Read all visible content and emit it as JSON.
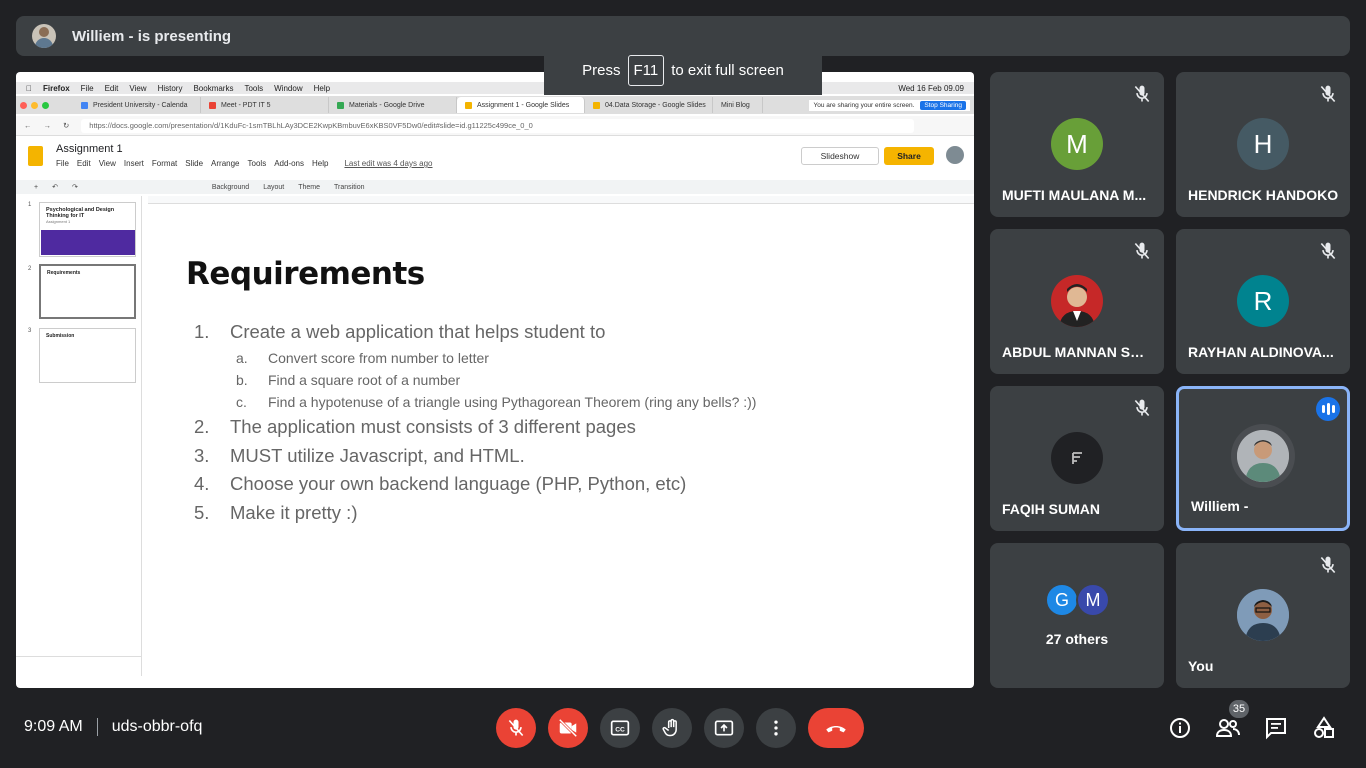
{
  "presenting": {
    "label": "Williem - is presenting"
  },
  "fullscreen_toast": {
    "press": "Press",
    "key": "F11",
    "suffix": "to exit full screen"
  },
  "shared_screen": {
    "mac_menu": [
      "Firefox",
      "File",
      "Edit",
      "View",
      "History",
      "Bookmarks",
      "Tools",
      "Window",
      "Help"
    ],
    "clock": "Wed 16 Feb  09.09",
    "tabs": [
      {
        "label": "President University - Calenda",
        "color": "#4285f4"
      },
      {
        "label": "Meet - PDT IT 5",
        "color": "#ea4335"
      },
      {
        "label": "Materials - Google Drive",
        "color": "#34a853"
      },
      {
        "label": "Assignment 1 - Google Slides",
        "color": "#f4b400"
      },
      {
        "label": "04.Data Storage - Google Slides",
        "color": "#f4b400"
      },
      {
        "label": "Mini Blog",
        "color": "#888888"
      }
    ],
    "share_notice": "You are sharing your entire screen.",
    "stop_sharing": "Stop Sharing",
    "url": "https://docs.google.com/presentation/d/1KduFc-1smTBLhLAy3DCE2KwpKBmbuvE6xKBS0VF5Dw0/edit#slide=id.g11225c499ce_0_0",
    "doc_title": "Assignment 1",
    "doc_menu": [
      "File",
      "Edit",
      "View",
      "Insert",
      "Format",
      "Slide",
      "Arrange",
      "Tools",
      "Add-ons",
      "Help"
    ],
    "last_edit": "Last edit was 4 days ago",
    "slideshow": "Slideshow",
    "share": "Share",
    "toolbar": [
      "Background",
      "Layout",
      "Theme",
      "Transition"
    ],
    "thumbnails": [
      {
        "num": "1",
        "title": "Psychological and Design Thinking for IT",
        "subtitle": "Assignment 1"
      },
      {
        "num": "2",
        "title": "Requirements"
      },
      {
        "num": "3",
        "title": "Submission"
      }
    ],
    "slide": {
      "title": "Requirements",
      "items": [
        {
          "num": "1.",
          "text": "Create a web application that helps student to"
        },
        {
          "num": "a.",
          "text": "Convert score from number to letter"
        },
        {
          "num": "b.",
          "text": "Find a square root of a number"
        },
        {
          "num": "c.",
          "text": "Find a hypotenuse of a triangle using Pythagorean Theorem (ring any bells? :))"
        },
        {
          "num": "2.",
          "text": "The application must consists of 3 different pages"
        },
        {
          "num": "3.",
          "text": "MUST utilize Javascript, and HTML."
        },
        {
          "num": "4.",
          "text": "Choose your own backend language (PHP, Python, etc)"
        },
        {
          "num": "5.",
          "text": "Make it pretty :)"
        }
      ]
    }
  },
  "participants": [
    {
      "name": "MUFTI MAULANA M...",
      "initial": "M",
      "color": "#689f38",
      "muted": true
    },
    {
      "name": "HENDRICK HANDOKO",
      "initial": "H",
      "color": "#455a64",
      "muted": true
    },
    {
      "name": "ABDUL MANNAN SAI...",
      "initial": "",
      "color": "#c62828",
      "muted": true
    },
    {
      "name": "RAYHAN ALDINOVA...",
      "initial": "R",
      "color": "#00838f",
      "muted": true
    },
    {
      "name": "FAQIH SUMAN",
      "initial": "",
      "color": "#202124",
      "muted": true
    },
    {
      "name": "Williem -",
      "initial": "",
      "color": "#9e9e9e",
      "muted": false,
      "speaking": true
    },
    {
      "name": "27 others",
      "initials": [
        "G",
        "M"
      ],
      "colors": [
        "#1e88e5",
        "#3949ab"
      ]
    },
    {
      "name": "You",
      "initial": "",
      "color": "#5d7da3",
      "muted": true
    }
  ],
  "bottom_bar": {
    "time": "9:09 AM",
    "meeting_code": "uds-obbr-ofq",
    "people_count": "35"
  }
}
